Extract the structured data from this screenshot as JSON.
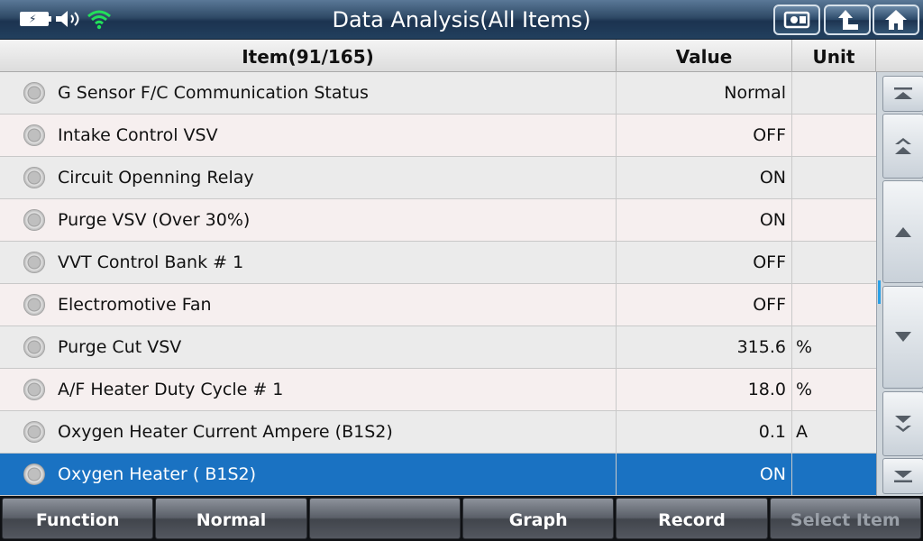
{
  "header": {
    "title": "Data Analysis(All Items)",
    "icons": [
      "battery-charging-icon",
      "speaker-icon",
      "wifi-icon"
    ],
    "buttons": [
      "screenshot-icon",
      "back-arrow-icon",
      "home-icon"
    ]
  },
  "table": {
    "columns": {
      "item": "Item(91/165)",
      "value": "Value",
      "unit": "Unit"
    },
    "rows": [
      {
        "item": "G Sensor F/C Communication Status",
        "value": "Normal",
        "unit": ""
      },
      {
        "item": "Intake Control VSV",
        "value": "OFF",
        "unit": ""
      },
      {
        "item": "Circuit Openning Relay",
        "value": "ON",
        "unit": ""
      },
      {
        "item": "Purge VSV (Over 30%)",
        "value": "ON",
        "unit": ""
      },
      {
        "item": "VVT Control Bank # 1",
        "value": "OFF",
        "unit": ""
      },
      {
        "item": "Electromotive Fan",
        "value": "OFF",
        "unit": ""
      },
      {
        "item": "Purge Cut VSV",
        "value": "315.6",
        "unit": "%"
      },
      {
        "item": "A/F Heater Duty Cycle # 1",
        "value": "18.0",
        "unit": "%"
      },
      {
        "item": "Oxygen Heater Current Ampere (B1S2)",
        "value": "0.1",
        "unit": "A"
      },
      {
        "item": "Oxygen Heater ( B1S2)",
        "value": "ON",
        "unit": ""
      }
    ],
    "selected_index": 9
  },
  "scroll": {
    "buttons": [
      "scroll-top-icon",
      "page-up-icon",
      "line-up-icon",
      "line-down-icon",
      "page-down-icon",
      "scroll-bottom-icon"
    ]
  },
  "footer": {
    "function": "Function",
    "normal": "Normal",
    "empty": "",
    "graph": "Graph",
    "record": "Record",
    "select_item": "Select Item"
  },
  "colors": {
    "selected_row": "#1a72c2",
    "scroll_indicator": "#2aa0e6",
    "wifi": "#22e05a"
  }
}
